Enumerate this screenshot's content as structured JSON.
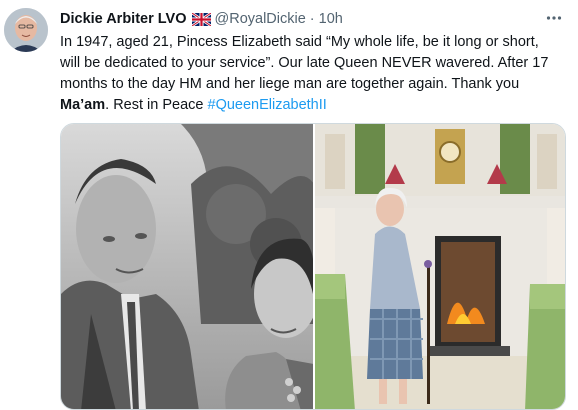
{
  "tweet": {
    "author_name": "Dickie Arbiter LVO",
    "flag_icon": "uk-flag-icon",
    "handle": "@RoyalDickie",
    "separator": "·",
    "time": "10h",
    "more_icon": "more-options-icon",
    "text_segments": [
      {
        "text": "In 1947, aged 21, Pincess Elizabeth said “My whole life, be it long or short, will be dedicated to your service”. Our late Queen NEVER wavered. After 17 months to the day HM and her liege man are together again. Thank you ",
        "style": "normal"
      },
      {
        "text": "Ma’am",
        "style": "bold"
      },
      {
        "text": ". Rest in Peace ",
        "style": "normal"
      },
      {
        "text": "#QueenElizabethII",
        "style": "hashtag"
      }
    ],
    "media": [
      {
        "name": "black-and-white-couple-photo",
        "kind": "monochrome"
      },
      {
        "name": "queen-by-fireplace-photo",
        "kind": "color"
      }
    ]
  },
  "colors": {
    "text": "#0f1419",
    "secondary": "#536471",
    "link": "#1d9bf0",
    "border": "#cfd9de"
  }
}
